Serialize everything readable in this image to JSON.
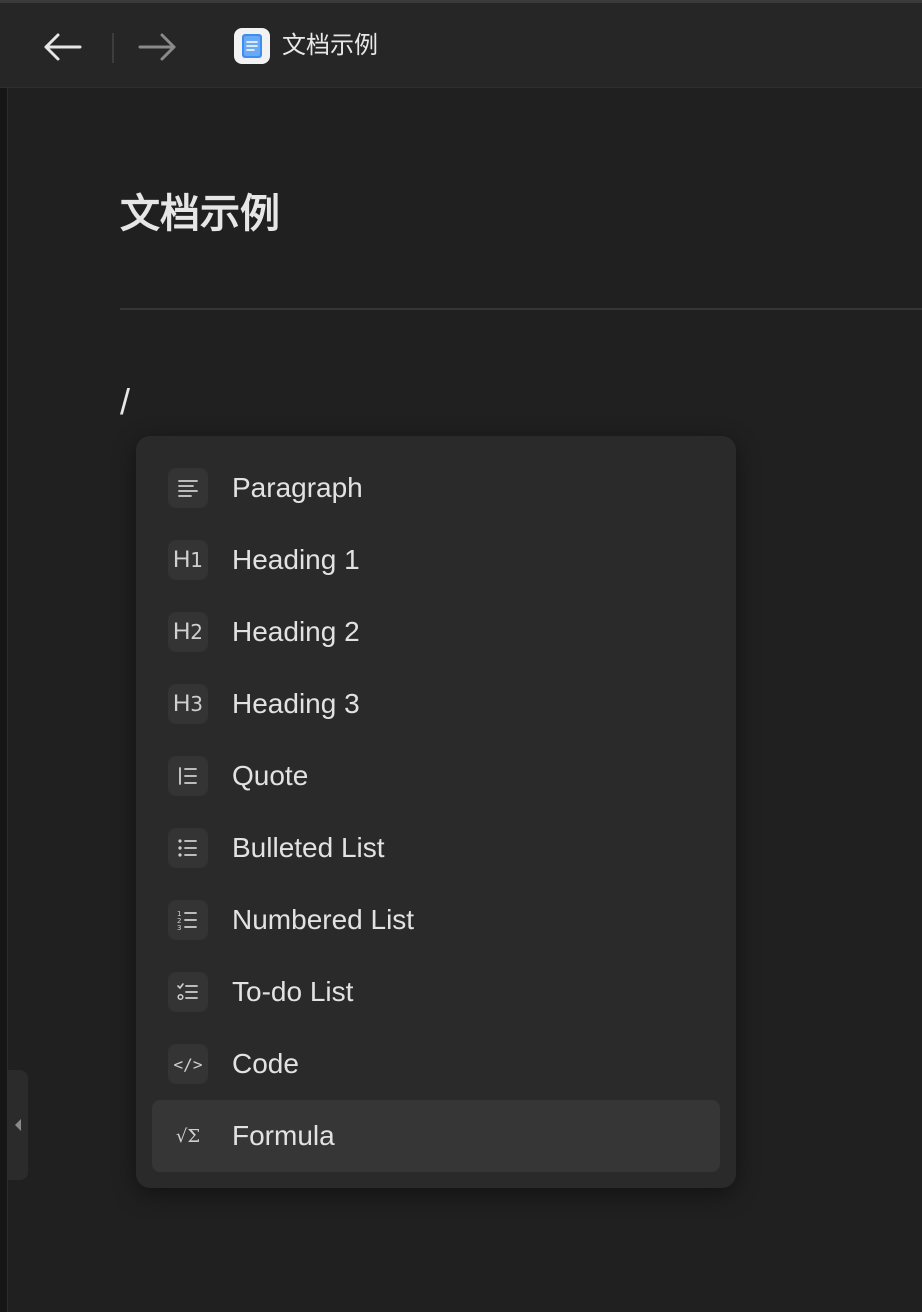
{
  "header": {
    "back_label": "back",
    "forward_label": "forward",
    "doc_title": "文档示例"
  },
  "editor": {
    "page_title": "文档示例",
    "typed_text": "/"
  },
  "slash_menu": {
    "items": [
      {
        "label": "Paragraph",
        "icon": "paragraph-icon"
      },
      {
        "label": "Heading 1",
        "icon": "heading-1-icon",
        "glyph": "H",
        "sub": "1"
      },
      {
        "label": "Heading 2",
        "icon": "heading-2-icon",
        "glyph": "H",
        "sub": "2"
      },
      {
        "label": "Heading 3",
        "icon": "heading-3-icon",
        "glyph": "H",
        "sub": "3"
      },
      {
        "label": "Quote",
        "icon": "quote-icon"
      },
      {
        "label": "Bulleted List",
        "icon": "bulleted-list-icon"
      },
      {
        "label": "Numbered List",
        "icon": "numbered-list-icon"
      },
      {
        "label": "To-do List",
        "icon": "todo-list-icon"
      },
      {
        "label": "Code",
        "icon": "code-icon",
        "glyph": "</>"
      },
      {
        "label": "Formula",
        "icon": "formula-icon",
        "glyph": "√Σ"
      }
    ],
    "selected_index": 9
  },
  "colors": {
    "background": "#202020",
    "titlebar": "#262626",
    "menu_bg": "#2a2a2a",
    "menu_active": "#363636",
    "text": "#e6e6e6",
    "doc_icon_blue": "#3d8ef0"
  }
}
